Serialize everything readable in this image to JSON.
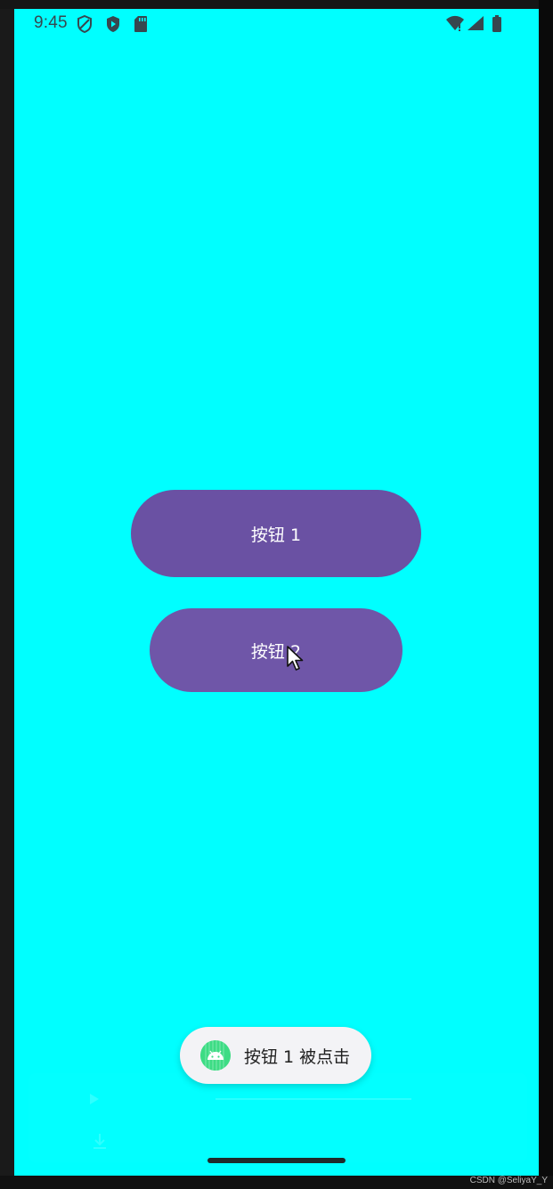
{
  "status_bar": {
    "time": "9:45",
    "icons": [
      "shield-icon",
      "play-protect-icon",
      "sd-card-icon",
      "wifi-icon",
      "signal-icon",
      "battery-icon"
    ]
  },
  "colors": {
    "background": "#00ffff",
    "button": "#6a51a3",
    "toast_bg": "#f3f3f6",
    "android_green": "#3ddc84"
  },
  "buttons": {
    "button1_label": "按钮 1",
    "button2_label": "按钮 2"
  },
  "toast": {
    "message": "按钮 1 被点击",
    "icon": "android-icon"
  },
  "watermark": "CSDN @SeliyaY_Y"
}
